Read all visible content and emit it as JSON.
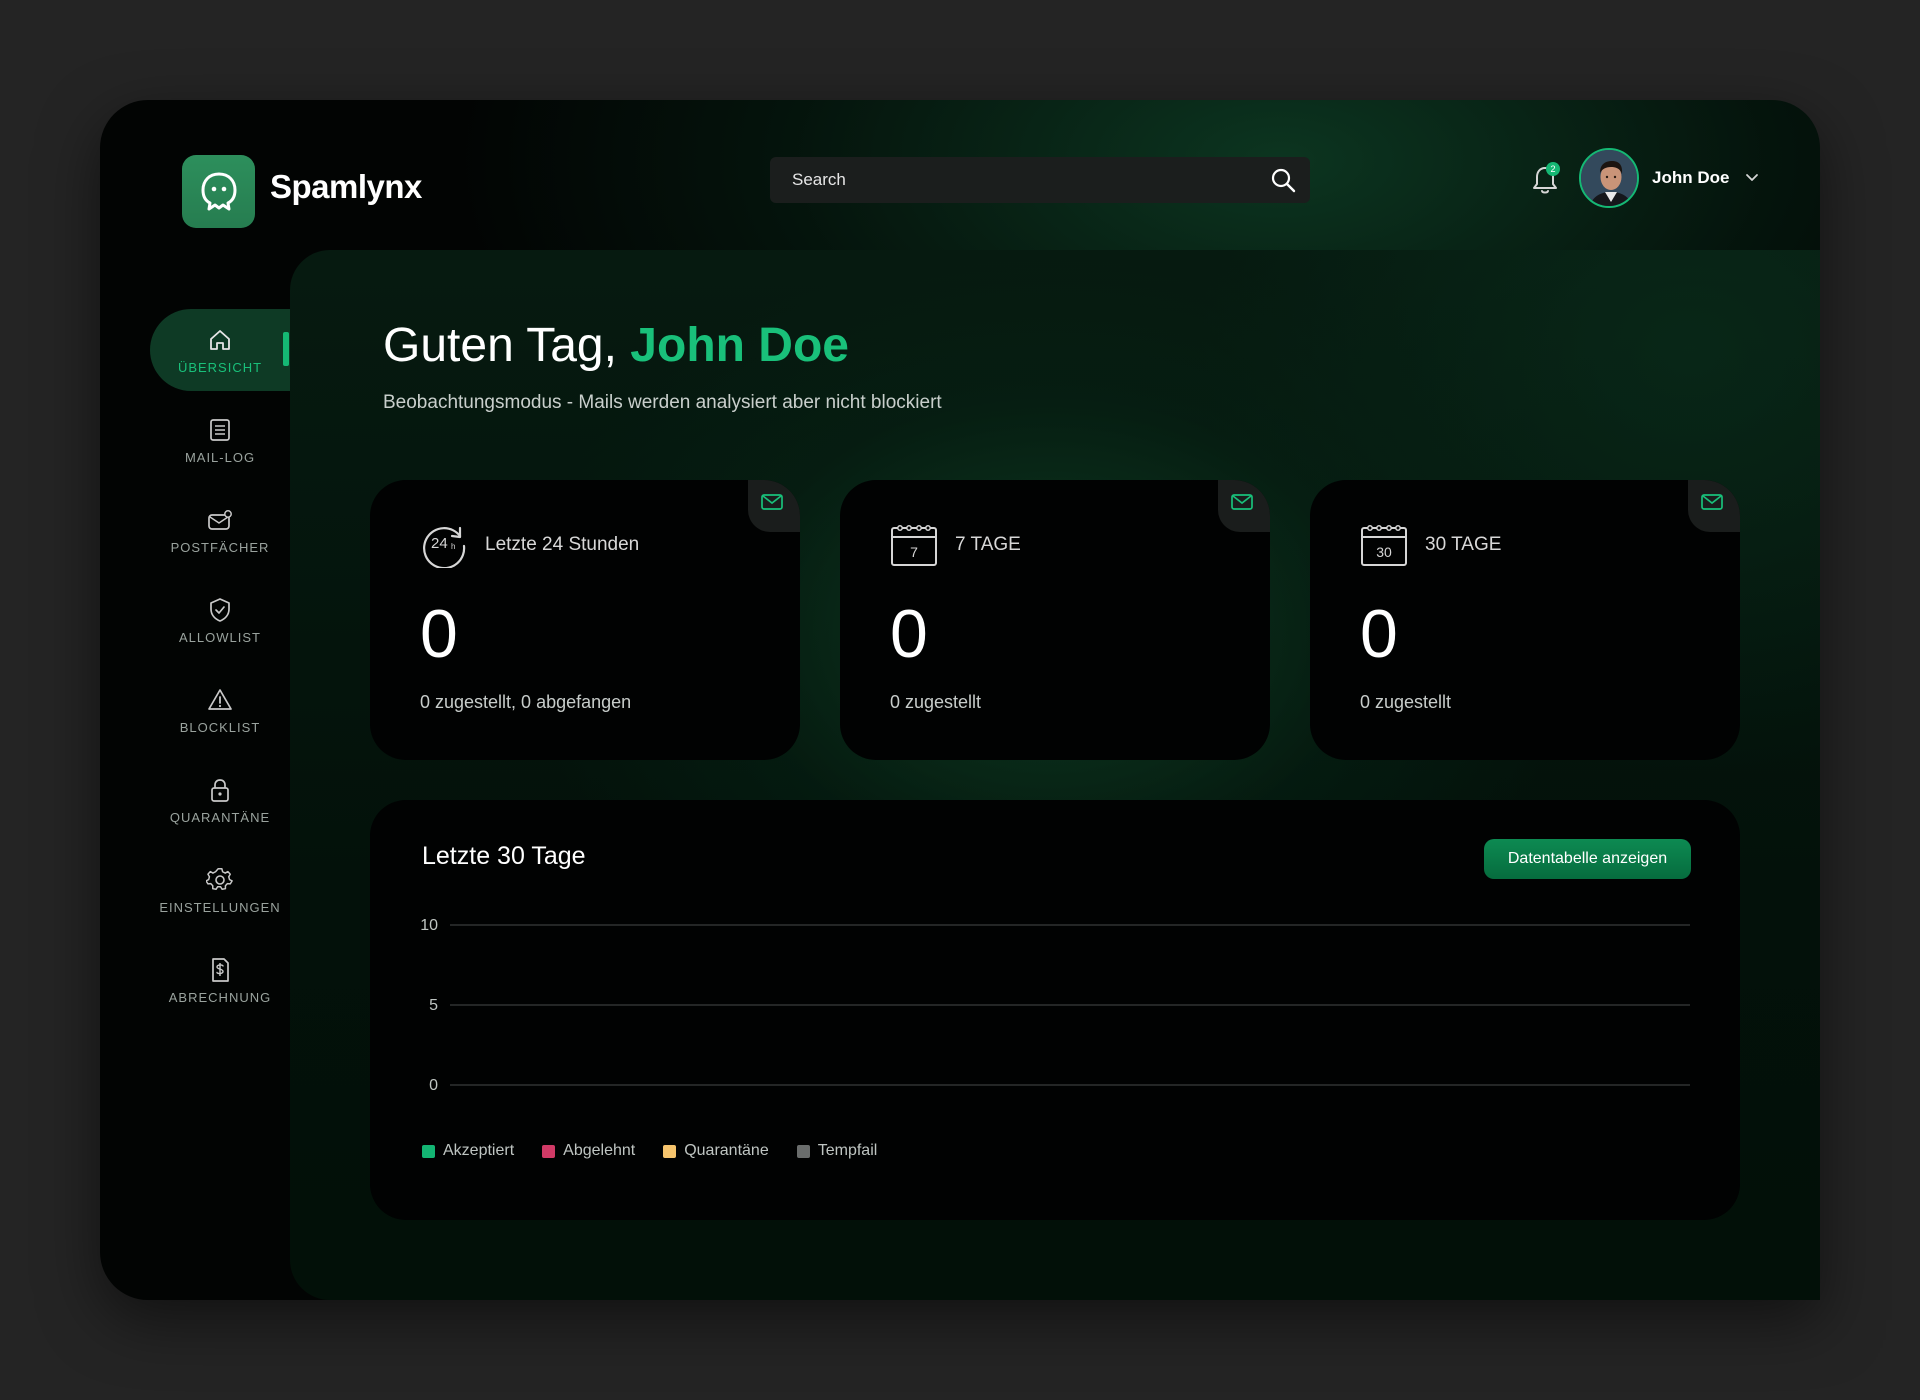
{
  "app": {
    "name": "Spamlynx"
  },
  "search": {
    "placeholder": "Search"
  },
  "notifications": {
    "count": "2"
  },
  "user": {
    "name": "John Doe"
  },
  "sidebar": {
    "items": [
      {
        "label": "ÜBERSICHT",
        "icon": "home-icon",
        "active": true
      },
      {
        "label": "MAIL-LOG",
        "icon": "list-icon"
      },
      {
        "label": "POSTFÄCHER",
        "icon": "mailbox-icon"
      },
      {
        "label": "ALLOWLIST",
        "icon": "shield-check-icon"
      },
      {
        "label": "BLOCKLIST",
        "icon": "warning-icon"
      },
      {
        "label": "QUARANTÄNE",
        "icon": "lock-icon"
      },
      {
        "label": "EINSTELLUNGEN",
        "icon": "gear-icon"
      },
      {
        "label": "ABRECHNUNG",
        "icon": "invoice-icon"
      }
    ]
  },
  "greeting": {
    "prefix": "Guten Tag,",
    "name": "John Doe"
  },
  "subtitle": "Beobachtungsmodus - Mails werden analysiert aber nicht blockiert",
  "cards": [
    {
      "title": "Letzte 24 Stunden",
      "value": "0",
      "sub": "0 zugestellt, 0 abgefangen",
      "icon_text": "24",
      "icon_sub": "h"
    },
    {
      "title": "7 TAGE",
      "value": "0",
      "sub": "0 zugestellt",
      "icon_text": "7"
    },
    {
      "title": "30 TAGE",
      "value": "0",
      "sub": "0 zugestellt",
      "icon_text": "30"
    }
  ],
  "chart": {
    "title": "Letzte 30 Tage",
    "button": "Datentabelle anzeigen"
  },
  "colors": {
    "accent": "#19c07a",
    "accepted": "#13b573",
    "rejected": "#d13a66",
    "quarantine": "#f6c46d",
    "tempfail": "#6a6d6c"
  },
  "chart_data": {
    "type": "line",
    "x": [],
    "series": [
      {
        "name": "Akzeptiert",
        "values": []
      },
      {
        "name": "Abgelehnt",
        "values": []
      },
      {
        "name": "Quarantäne",
        "values": []
      },
      {
        "name": "Tempfail",
        "values": []
      }
    ],
    "yticks": [
      "10",
      "5",
      "0"
    ],
    "ylim": [
      0,
      10
    ],
    "grid": true,
    "legend": "bottom-left"
  }
}
